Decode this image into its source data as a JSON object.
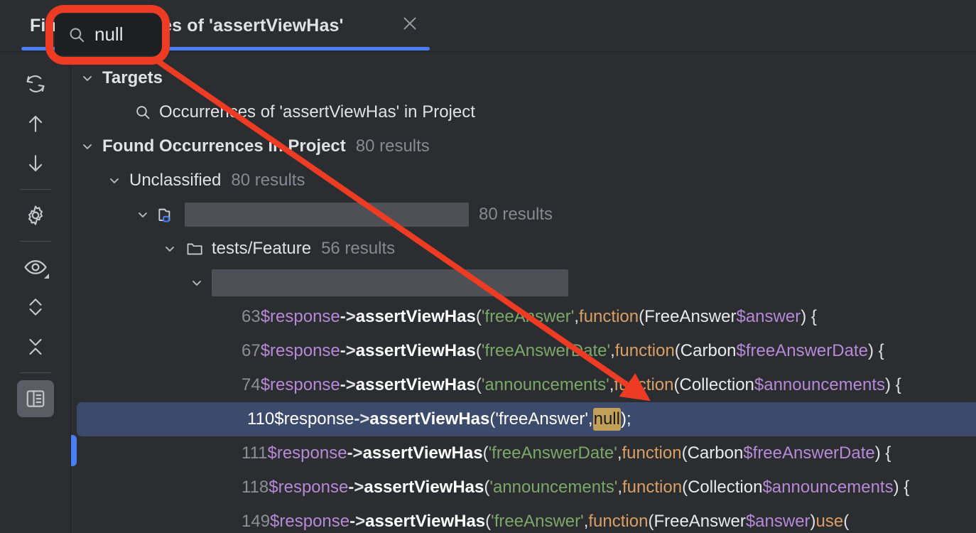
{
  "window": {
    "tool_name": "Find",
    "tab_title": "Find Occurrences of 'assertViewHas'",
    "close_label": "×",
    "accent_color": "#4a7ef5",
    "background_color": "#2b2d30"
  },
  "search_popup": {
    "icon": "search-icon",
    "value": "null",
    "placeholder": "Search",
    "annotation_color": "#ee3b24"
  },
  "toolbar": {
    "items": [
      {
        "name": "rerun-search-button",
        "icon": "refresh-icon",
        "label": "Rerun Search"
      },
      {
        "name": "previous-occurrence-button",
        "icon": "arrow-up-icon",
        "label": "Previous Occurrence"
      },
      {
        "name": "next-occurrence-button",
        "icon": "arrow-down-icon",
        "label": "Next Occurrence"
      },
      {
        "name": "settings-button",
        "icon": "gear-icon",
        "label": "Settings"
      },
      {
        "name": "view-options-button",
        "icon": "eye-icon",
        "label": "View Options"
      },
      {
        "name": "expand-all-button",
        "icon": "expand-all-icon",
        "label": "Expand All"
      },
      {
        "name": "collapse-all-button",
        "icon": "collapse-all-icon",
        "label": "Collapse All"
      },
      {
        "name": "preview-toggle-button",
        "icon": "preview-panel-icon",
        "label": "Open Preview",
        "selected": true
      }
    ]
  },
  "tree": {
    "targets": {
      "label": "Targets",
      "child": {
        "icon": "search-icon",
        "label": "Occurrences of 'assertViewHas' in Project"
      }
    },
    "found": {
      "label": "Found Occurrences in Project",
      "count": "80 results",
      "unclassified": {
        "label": "Unclassified",
        "count": "80 results",
        "module": {
          "icon": "module-folder-icon",
          "label": "",
          "redacted": true,
          "count": "80 results",
          "folders": [
            {
              "icon": "folder-icon",
              "label": "tests/Feature",
              "count": "56 results",
              "file": {
                "label": "",
                "redacted": true,
                "matches": [
                  {
                    "line": "63",
                    "selected": false,
                    "tokens": [
                      {
                        "t": "var",
                        "v": "$response"
                      },
                      {
                        "t": "arrow",
                        "v": "->"
                      },
                      {
                        "t": "call",
                        "v": "assertViewHas"
                      },
                      {
                        "t": "punc",
                        "v": "("
                      },
                      {
                        "t": "str",
                        "v": "'freeAnswer'"
                      },
                      {
                        "t": "punc",
                        "v": ", "
                      },
                      {
                        "t": "kw",
                        "v": "function"
                      },
                      {
                        "t": "punc",
                        "v": " ("
                      },
                      {
                        "t": "cls",
                        "v": "FreeAnswer "
                      },
                      {
                        "t": "var",
                        "v": "$answer"
                      },
                      {
                        "t": "punc",
                        "v": ") {"
                      }
                    ]
                  },
                  {
                    "line": "67",
                    "selected": false,
                    "tokens": [
                      {
                        "t": "var",
                        "v": "$response"
                      },
                      {
                        "t": "arrow",
                        "v": "->"
                      },
                      {
                        "t": "call",
                        "v": "assertViewHas"
                      },
                      {
                        "t": "punc",
                        "v": "("
                      },
                      {
                        "t": "str",
                        "v": "'freeAnswerDate'"
                      },
                      {
                        "t": "punc",
                        "v": ", "
                      },
                      {
                        "t": "kw",
                        "v": "function"
                      },
                      {
                        "t": "punc",
                        "v": " ("
                      },
                      {
                        "t": "cls",
                        "v": "Carbon "
                      },
                      {
                        "t": "var",
                        "v": "$freeAnswerDate"
                      },
                      {
                        "t": "punc",
                        "v": ") {"
                      }
                    ]
                  },
                  {
                    "line": "74",
                    "selected": false,
                    "tokens": [
                      {
                        "t": "var",
                        "v": "$response"
                      },
                      {
                        "t": "arrow",
                        "v": "->"
                      },
                      {
                        "t": "call",
                        "v": "assertViewHas"
                      },
                      {
                        "t": "punc",
                        "v": "("
                      },
                      {
                        "t": "str",
                        "v": "'announcements'"
                      },
                      {
                        "t": "punc",
                        "v": ", "
                      },
                      {
                        "t": "kw",
                        "v": "function"
                      },
                      {
                        "t": "punc",
                        "v": " ("
                      },
                      {
                        "t": "cls",
                        "v": "Collection "
                      },
                      {
                        "t": "var",
                        "v": "$announcements"
                      },
                      {
                        "t": "punc",
                        "v": ") {"
                      }
                    ]
                  },
                  {
                    "line": "110",
                    "selected": true,
                    "tokens": [
                      {
                        "t": "var",
                        "v": "$response"
                      },
                      {
                        "t": "arrow",
                        "v": "->"
                      },
                      {
                        "t": "call",
                        "v": "assertViewHas"
                      },
                      {
                        "t": "punc",
                        "v": "("
                      },
                      {
                        "t": "str",
                        "v": "'freeAnswer'"
                      },
                      {
                        "t": "punc",
                        "v": ", "
                      },
                      {
                        "t": "hl",
                        "v": "null"
                      },
                      {
                        "t": "punc",
                        "v": ");"
                      }
                    ]
                  },
                  {
                    "line": "111",
                    "selected": false,
                    "tokens": [
                      {
                        "t": "var",
                        "v": "$response"
                      },
                      {
                        "t": "arrow",
                        "v": "->"
                      },
                      {
                        "t": "call",
                        "v": "assertViewHas"
                      },
                      {
                        "t": "punc",
                        "v": "("
                      },
                      {
                        "t": "str",
                        "v": "'freeAnswerDate'"
                      },
                      {
                        "t": "punc",
                        "v": ", "
                      },
                      {
                        "t": "kw",
                        "v": "function"
                      },
                      {
                        "t": "punc",
                        "v": " ("
                      },
                      {
                        "t": "cls",
                        "v": "Carbon "
                      },
                      {
                        "t": "var",
                        "v": "$freeAnswerDate"
                      },
                      {
                        "t": "punc",
                        "v": ") {"
                      }
                    ]
                  },
                  {
                    "line": "118",
                    "selected": false,
                    "tokens": [
                      {
                        "t": "var",
                        "v": "$response"
                      },
                      {
                        "t": "arrow",
                        "v": "->"
                      },
                      {
                        "t": "call",
                        "v": "assertViewHas"
                      },
                      {
                        "t": "punc",
                        "v": "("
                      },
                      {
                        "t": "str",
                        "v": "'announcements'"
                      },
                      {
                        "t": "punc",
                        "v": ", "
                      },
                      {
                        "t": "kw",
                        "v": "function"
                      },
                      {
                        "t": "punc",
                        "v": " ("
                      },
                      {
                        "t": "cls",
                        "v": "Collection "
                      },
                      {
                        "t": "var",
                        "v": "$announcements"
                      },
                      {
                        "t": "punc",
                        "v": ") {"
                      }
                    ]
                  },
                  {
                    "line": "149",
                    "selected": false,
                    "tokens": [
                      {
                        "t": "var",
                        "v": "$response"
                      },
                      {
                        "t": "arrow",
                        "v": "->"
                      },
                      {
                        "t": "call",
                        "v": "assertViewHas"
                      },
                      {
                        "t": "punc",
                        "v": "("
                      },
                      {
                        "t": "str",
                        "v": "'freeAnswer'"
                      },
                      {
                        "t": "punc",
                        "v": ", "
                      },
                      {
                        "t": "kw",
                        "v": "function"
                      },
                      {
                        "t": "punc",
                        "v": " ("
                      },
                      {
                        "t": "cls",
                        "v": "FreeAnswer "
                      },
                      {
                        "t": "var",
                        "v": "$answer"
                      },
                      {
                        "t": "punc",
                        "v": ") "
                      },
                      {
                        "t": "kw",
                        "v": "use"
                      },
                      {
                        "t": "punc",
                        "v": " ("
                      }
                    ]
                  }
                ]
              }
            }
          ]
        }
      }
    }
  }
}
